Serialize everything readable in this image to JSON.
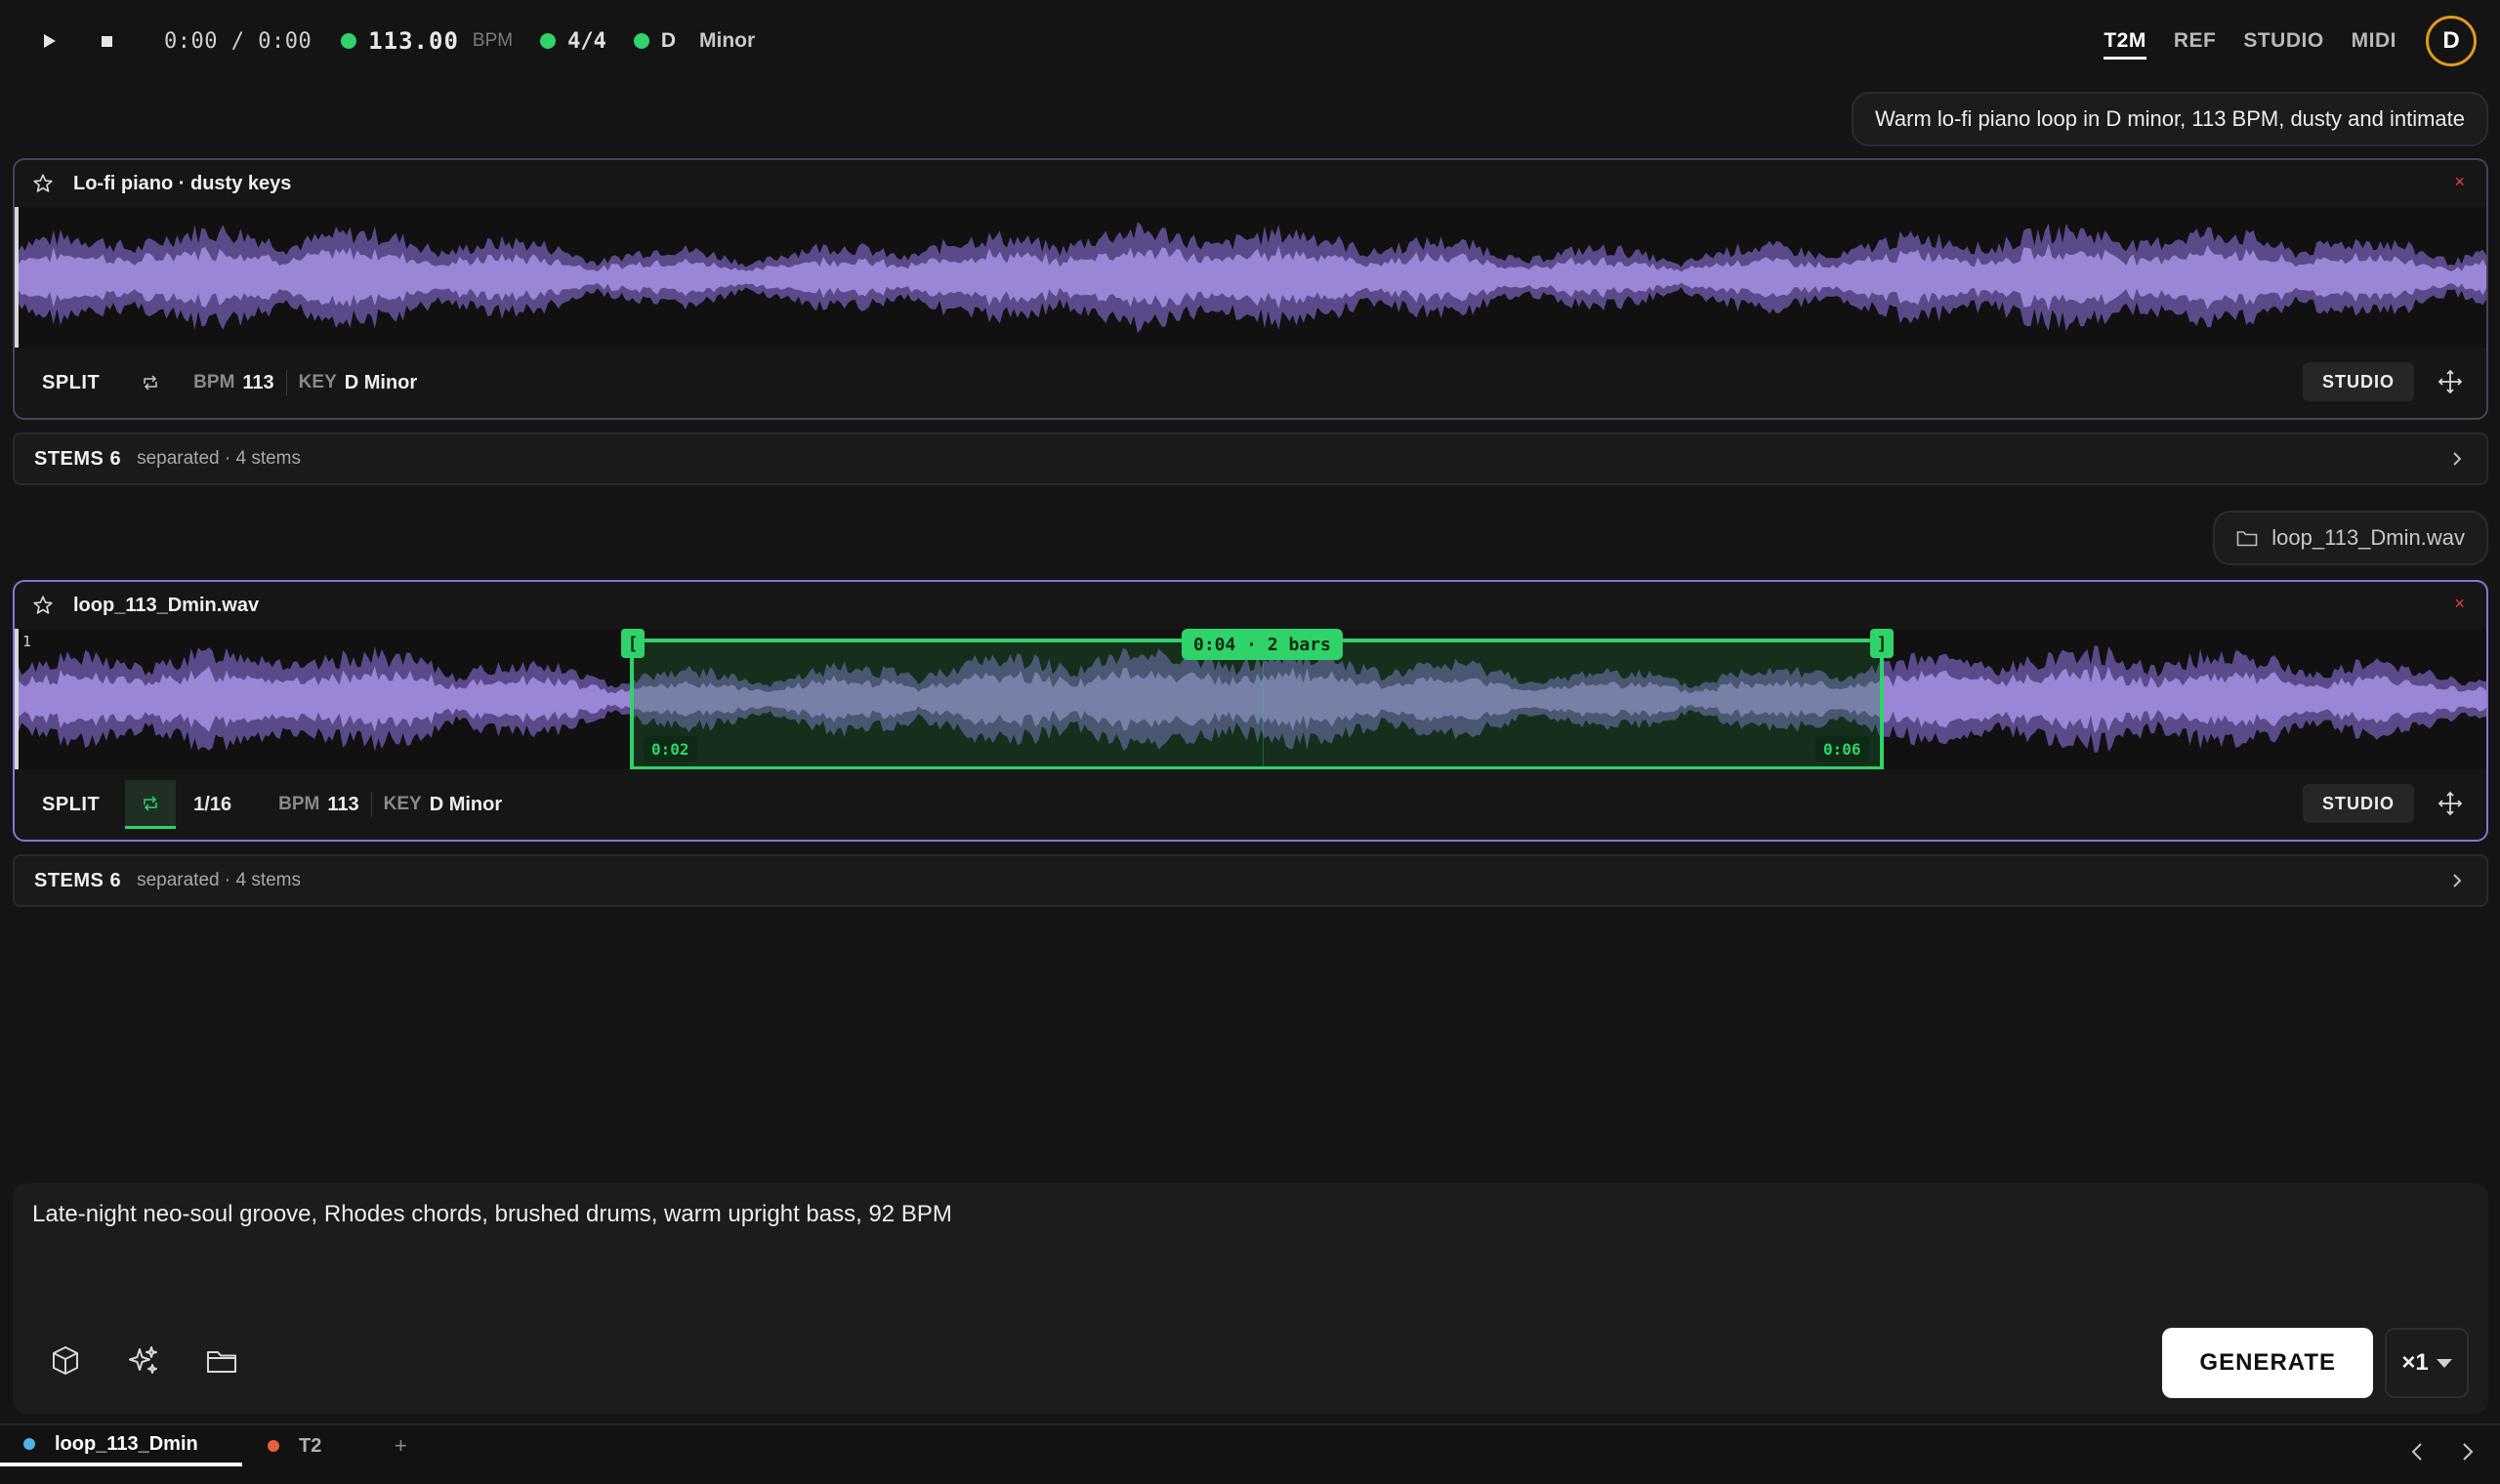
{
  "transport": {
    "time": "0:00 / 0:00",
    "bpm": "113.00",
    "bpm_unit": "BPM",
    "time_signature": "4/4",
    "key_root": "D",
    "key_mode": "Minor"
  },
  "modes": [
    {
      "label": "T2M",
      "active": true
    },
    {
      "label": "REF",
      "active": false
    },
    {
      "label": "STUDIO",
      "active": false
    },
    {
      "label": "MIDI",
      "active": false
    }
  ],
  "avatar": {
    "initial": "D"
  },
  "prompt_pill_1": "Warm lo-fi piano loop in D minor, 113 BPM, dusty and intimate",
  "prompt_pill_2": "loop_113_Dmin.wav",
  "tracks": [
    {
      "title": "Lo-fi piano · dusty keys",
      "close": "×",
      "split": "SPLIT",
      "bpm_label": "BPM",
      "bpm_value": "113",
      "key_label": "KEY",
      "key_value": "D Minor",
      "studio": "STUDIO",
      "stems_label": "STEMS 6",
      "stems_sub": "separated · 4 stems"
    },
    {
      "title": "loop_113_Dmin.wav",
      "close": "×",
      "beat": "1",
      "split": "SPLIT",
      "grid": "1/16",
      "bpm_label": "BPM",
      "bpm_value": "113",
      "key_label": "KEY",
      "key_value": "D Minor",
      "studio": "STUDIO",
      "stems_label": "STEMS 6",
      "stems_sub": "separated · 4 stems",
      "region": {
        "badge": "0:04 · 2 bars",
        "start": "0:02",
        "end": "0:06",
        "left_handle": "[",
        "right_handle": "]"
      }
    }
  ],
  "composer": {
    "text": "Late-night neo-soul groove, Rhodes chords, brushed drums, warm upright bass, 92 BPM",
    "generate": "GENERATE",
    "count": "×1"
  },
  "tabs": [
    {
      "label": "loop_113_Dmin",
      "dot_color": "#4fb3e8",
      "active": true
    },
    {
      "label": "T2",
      "dot_color": "#e8603a",
      "active": false
    }
  ],
  "tab_add": "+",
  "colors": {
    "accent_green": "#2fd36a",
    "wave_outer": "#5a4a8a",
    "wave_inner": "#9b85d6",
    "avatar_ring": "#e09a1c",
    "active_border": "#8a74d6"
  },
  "icons": [
    "play-icon",
    "stop-icon",
    "star-icon",
    "close-icon",
    "loop-icon",
    "move-icon",
    "chevron-right-icon",
    "folder-icon",
    "cube-icon",
    "sparkle-icon",
    "chevron-left-icon",
    "caret-down-icon"
  ]
}
